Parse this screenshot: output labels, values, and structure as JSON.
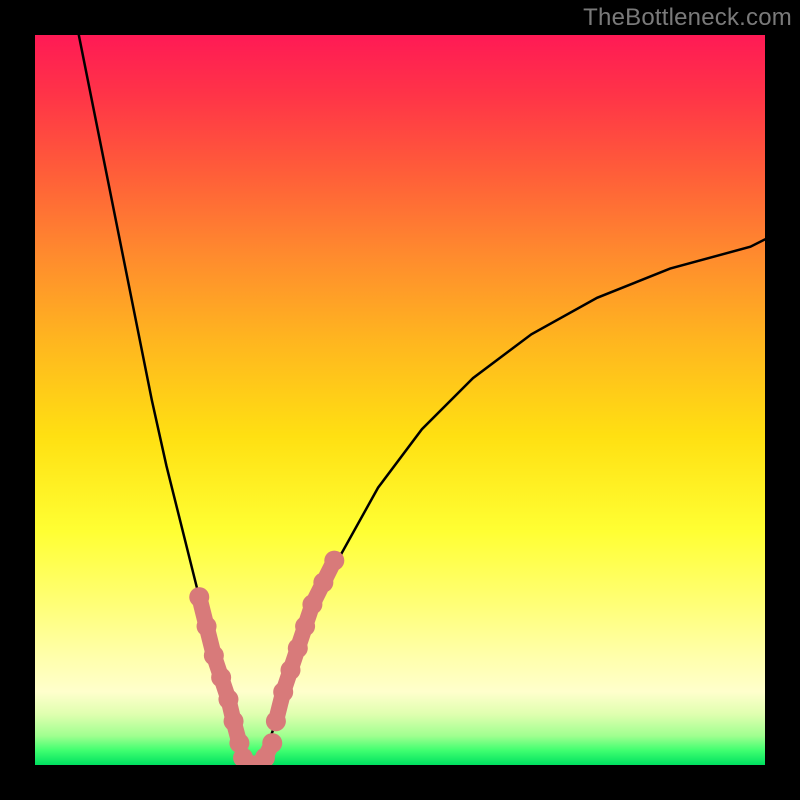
{
  "watermark": "TheBottleneck.com",
  "chart_data": {
    "type": "line",
    "title": "",
    "xlabel": "",
    "ylabel": "",
    "xlim": [
      0,
      100
    ],
    "ylim": [
      0,
      100
    ],
    "grid": false,
    "legend": false,
    "background": {
      "gradient_direction": "vertical",
      "stops": [
        {
          "pos": 0.0,
          "color": "#ff1a55"
        },
        {
          "pos": 0.3,
          "color": "#ff8a2e"
        },
        {
          "pos": 0.55,
          "color": "#ffe012"
        },
        {
          "pos": 0.78,
          "color": "#ffff77"
        },
        {
          "pos": 0.93,
          "color": "#e0ffb0"
        },
        {
          "pos": 1.0,
          "color": "#00e060"
        }
      ]
    },
    "series": [
      {
        "name": "curve-left",
        "style": "line",
        "color": "#000000",
        "x": [
          6,
          8,
          10,
          12,
          14,
          16,
          18,
          20,
          22,
          24,
          25,
          26,
          27,
          28,
          29,
          30
        ],
        "y": [
          100,
          90,
          80,
          70,
          60,
          50,
          41,
          33,
          25,
          17,
          13,
          9,
          6,
          3,
          1,
          0
        ]
      },
      {
        "name": "curve-right",
        "style": "line",
        "color": "#000000",
        "x": [
          30,
          31,
          32,
          33,
          35,
          38,
          42,
          47,
          53,
          60,
          68,
          77,
          87,
          98,
          100
        ],
        "y": [
          0,
          1,
          3,
          6,
          12,
          20,
          29,
          38,
          46,
          53,
          59,
          64,
          68,
          71,
          72
        ]
      },
      {
        "name": "markers-left-branch",
        "style": "scatter",
        "color": "#d87a7a",
        "marker_size": 10,
        "x": [
          22.5,
          23.5,
          24.5,
          25.5,
          26.5,
          27.2,
          28.0
        ],
        "y": [
          23,
          19,
          15,
          12,
          9,
          6,
          3
        ]
      },
      {
        "name": "markers-right-branch",
        "style": "scatter",
        "color": "#d87a7a",
        "marker_size": 10,
        "x": [
          33.0,
          34.0,
          35.0,
          36.0,
          37.0,
          38.0,
          39.5,
          41.0
        ],
        "y": [
          6,
          10,
          13,
          16,
          19,
          22,
          25,
          28
        ]
      },
      {
        "name": "markers-bottom",
        "style": "scatter",
        "color": "#d87a7a",
        "marker_size": 10,
        "x": [
          28.5,
          29.5,
          30.5,
          31.5,
          32.5
        ],
        "y": [
          1,
          0,
          0,
          1,
          3
        ]
      }
    ]
  }
}
